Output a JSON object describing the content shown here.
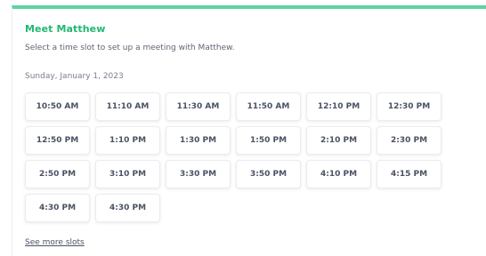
{
  "header": {
    "title": "Meet Matthew",
    "subtitle": "Select a time slot to set up a meeting with Matthew."
  },
  "date_label": "Sunday, January 1, 2023",
  "slots": [
    "10:50 AM",
    "11:10 AM",
    "11:30 AM",
    "11:50 AM",
    "12:10 PM",
    "12:30 PM",
    "12:50 PM",
    "1:10 PM",
    "1:30 PM",
    "1:50 PM",
    "2:10 PM",
    "2:30 PM",
    "2:50 PM",
    "3:10 PM",
    "3:30 PM",
    "3:50 PM",
    "4:10 PM",
    "4:15 PM",
    "4:30 PM",
    "4:30 PM"
  ],
  "footer": {
    "more_link": "See more slots"
  },
  "colors": {
    "accent": "#5ed3a2",
    "title": "#22b872",
    "slot_text": "#4a5263"
  }
}
